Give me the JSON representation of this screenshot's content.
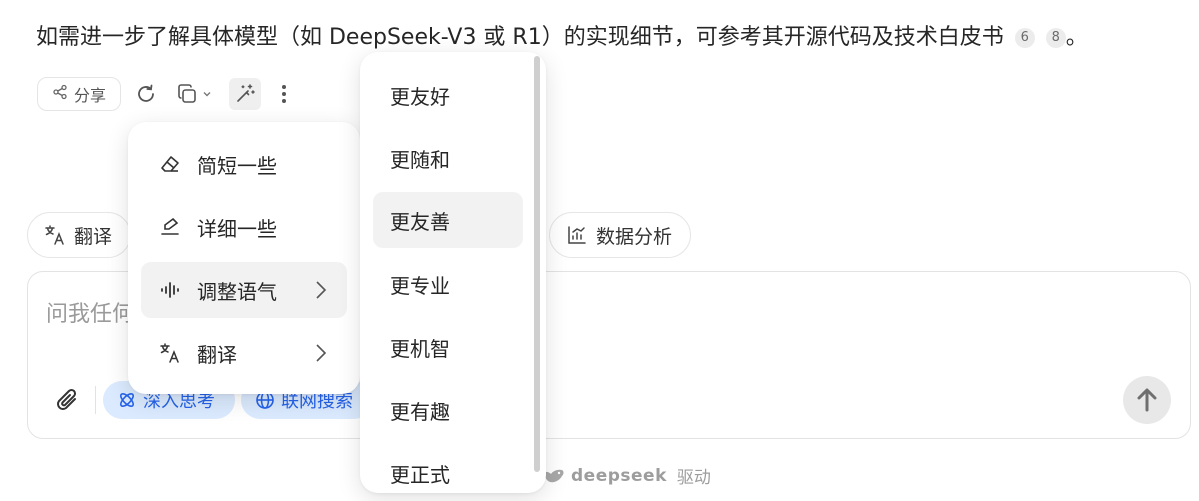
{
  "paragraph": {
    "text": "如需进一步了解具体模型（如 DeepSeek-V3 或 R1）的实现细节，可参考其开源代码及技术白皮书",
    "citations": [
      "6",
      "8"
    ],
    "end": "。"
  },
  "actions": {
    "share_label": "分享",
    "share_icon": "share-icon",
    "regenerate_icon": "refresh-icon",
    "copy_icon": "copy-icon",
    "magic_icon": "magic-wand-icon",
    "more_icon": "more-vertical-icon"
  },
  "chips": {
    "translate": "翻译",
    "data_analysis": "数据分析"
  },
  "input": {
    "placeholder_visible": "问我任何",
    "deep_think": "深入思考",
    "web_search": "联网搜索"
  },
  "footer": {
    "brand": "deepseek",
    "suffix": "驱动"
  },
  "rewrite_menu": {
    "items": [
      {
        "label": "简短一些",
        "icon": "eraser-icon"
      },
      {
        "label": "详细一些",
        "icon": "pen-icon"
      },
      {
        "label": "调整语气",
        "icon": "waveform-icon",
        "submenu": true
      },
      {
        "label": "翻译",
        "icon": "translate-icon",
        "submenu": true
      }
    ]
  },
  "tone_menu": {
    "items": [
      "更友好",
      "更随和",
      "更友善",
      "更专业",
      "更机智",
      "更有趣",
      "更正式"
    ],
    "highlighted": "更友善"
  },
  "colors": {
    "accent_blue": "#2563eb",
    "pill_bg": "#dbeafe"
  }
}
